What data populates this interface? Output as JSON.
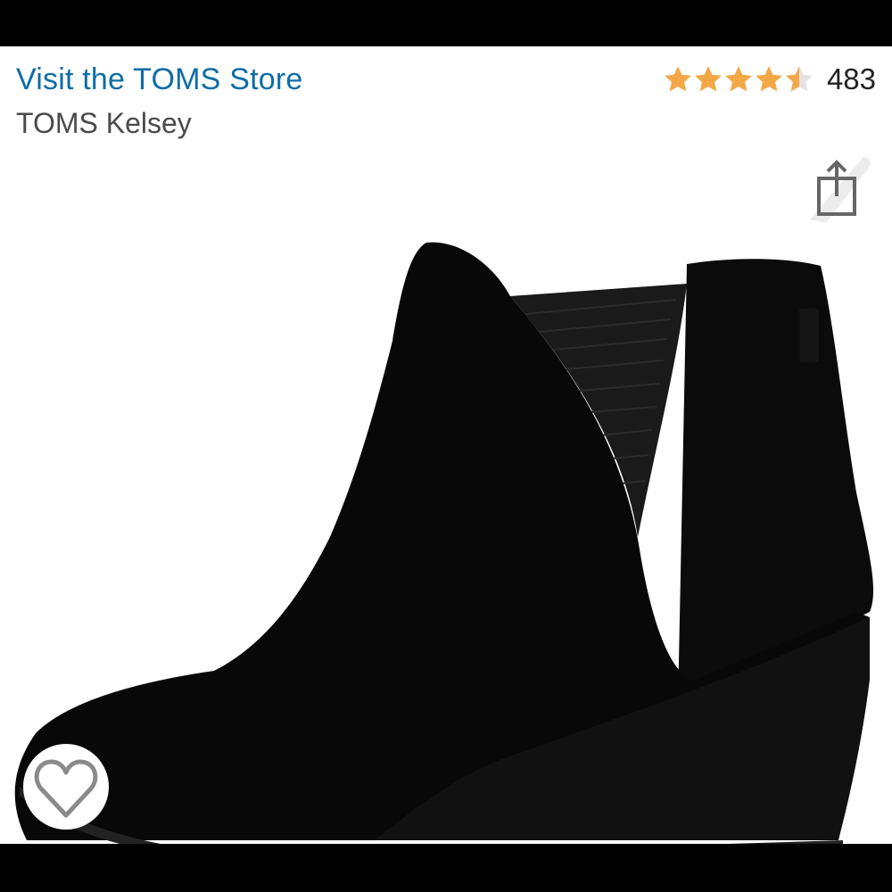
{
  "header": {
    "store_link": "Visit the TOMS Store",
    "product_title": "TOMS Kelsey"
  },
  "rating": {
    "value": 4.5,
    "max": 5,
    "count": "483",
    "star_color": "#f3a847"
  },
  "product": {
    "image_subject": "black suede wedge ankle bootie with elastic side panel"
  },
  "icons": {
    "share": "share-icon",
    "favorite": "heart-icon"
  },
  "colors": {
    "link": "#0f6da8",
    "title": "#4a4a4a",
    "frame": "#000000"
  }
}
